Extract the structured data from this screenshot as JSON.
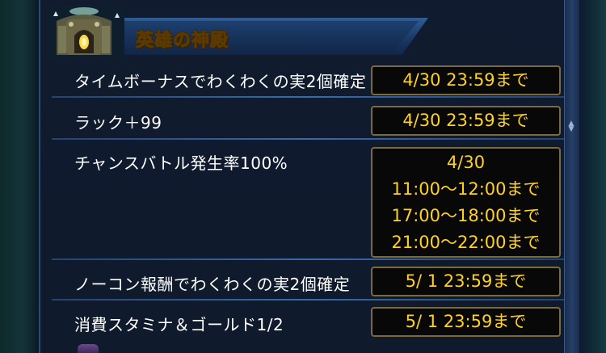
{
  "header": {
    "title": "英雄の神殿",
    "icon": "temple-icon"
  },
  "rows": [
    {
      "label": "タイムボーナスでわくわくの実2個確定",
      "times": [
        "4/30 23:59まで"
      ]
    },
    {
      "label": "ラック＋99",
      "times": [
        "4/30 23:59まで"
      ]
    },
    {
      "label": "チャンスバトル発生率100%",
      "times": [
        "4/30",
        "11:00〜12:00まで",
        "17:00〜18:00まで",
        "21:00〜22:00まで"
      ]
    },
    {
      "label": "ノーコン報酬でわくわくの実2個確定",
      "times": [
        "5/ 1 23:59まで"
      ]
    },
    {
      "label": "消費スタミナ＆ゴールド1/2",
      "times": [
        "5/ 1 23:59まで"
      ]
    }
  ],
  "colors": {
    "time_text": "#ffd21e",
    "title_text": "#ffe22a",
    "panel_bg": "#101b2f"
  }
}
